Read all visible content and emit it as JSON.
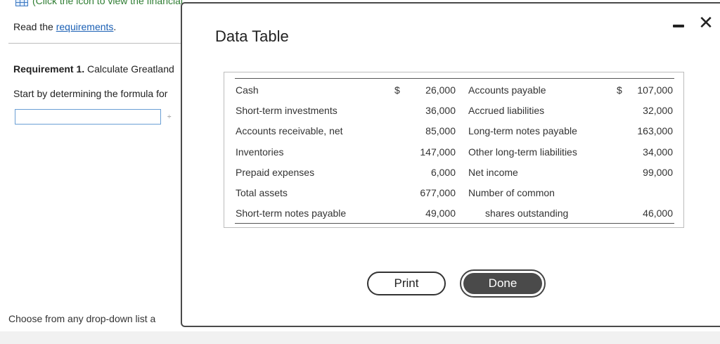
{
  "background": {
    "top_link": "(Click the icon to view the financial statement data.)",
    "read_prefix": "Read the ",
    "read_link": "requirements",
    "read_suffix": ".",
    "requirement_bold": "Requirement 1.",
    "requirement_text": " Calculate Greatland",
    "start_text": "Start by determining the formula for",
    "divide_symbol": "÷",
    "answer_value": "",
    "footer_text": "Choose from any drop-down list a"
  },
  "dialog": {
    "title": "Data Table",
    "minimize_icon": "minimize-icon",
    "close_icon": "close-icon",
    "close_glyph": "✕",
    "print_label": "Print",
    "done_label": "Done"
  },
  "table": {
    "left": [
      {
        "label": "Cash",
        "dollar": "$",
        "value": "26,000"
      },
      {
        "label": "Short-term investments",
        "dollar": "",
        "value": "36,000"
      },
      {
        "label": "Accounts receivable, net",
        "dollar": "",
        "value": "85,000"
      },
      {
        "label": "Inventories",
        "dollar": "",
        "value": "147,000"
      },
      {
        "label": "Prepaid expenses",
        "dollar": "",
        "value": "6,000"
      },
      {
        "label": "Total assets",
        "dollar": "",
        "value": "677,000"
      },
      {
        "label": "Short-term notes payable",
        "dollar": "",
        "value": "49,000"
      }
    ],
    "right": [
      {
        "label": "Accounts payable",
        "dollar": "$",
        "value": "107,000"
      },
      {
        "label": "Accrued liabilities",
        "dollar": "",
        "value": "32,000"
      },
      {
        "label": "Long-term notes payable",
        "dollar": "",
        "value": "163,000"
      },
      {
        "label": "Other long-term liabilities",
        "dollar": "",
        "value": "34,000"
      },
      {
        "label": "Net income",
        "dollar": "",
        "value": "99,000"
      },
      {
        "label": "Number of common",
        "dollar": "",
        "value": ""
      },
      {
        "label": "shares outstanding",
        "dollar": "",
        "value": "46,000"
      }
    ]
  }
}
